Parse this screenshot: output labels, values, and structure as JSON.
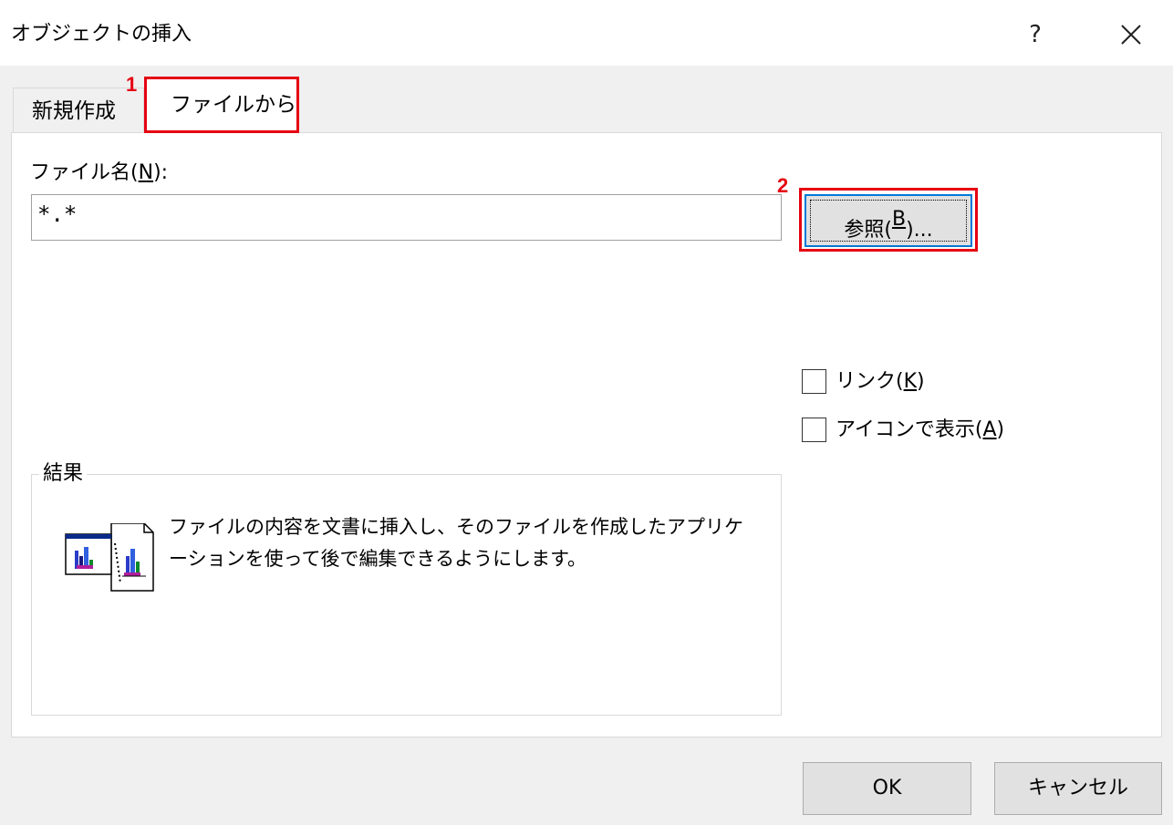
{
  "window": {
    "title": "オブジェクトの挿入",
    "help_label": "?",
    "close_icon": "close-icon"
  },
  "tabs": [
    {
      "label": "新規作成",
      "active": false
    },
    {
      "label": "ファイルから",
      "active": true
    }
  ],
  "annotations": {
    "badge_1": "1",
    "badge_2": "2",
    "highlight_color": "#e60012"
  },
  "file": {
    "label_prefix": "ファイル名(",
    "label_key": "N",
    "label_suffix": "):",
    "value": "*.*"
  },
  "browse": {
    "label_prefix": "参照(",
    "label_key": "B",
    "label_suffix": ")..."
  },
  "options": {
    "link": {
      "prefix": "リンク(",
      "key": "K",
      "suffix": ")",
      "checked": false
    },
    "icon": {
      "prefix": "アイコンで表示(",
      "key": "A",
      "suffix": ")",
      "checked": false
    }
  },
  "result": {
    "title": "結果",
    "description": "ファイルの内容を文書に挿入し、そのファイルを作成したアプリケーションを使って後で編集できるようにします。",
    "icon": "embedded-file-icon"
  },
  "buttons": {
    "ok": "OK",
    "cancel": "キャンセル"
  }
}
